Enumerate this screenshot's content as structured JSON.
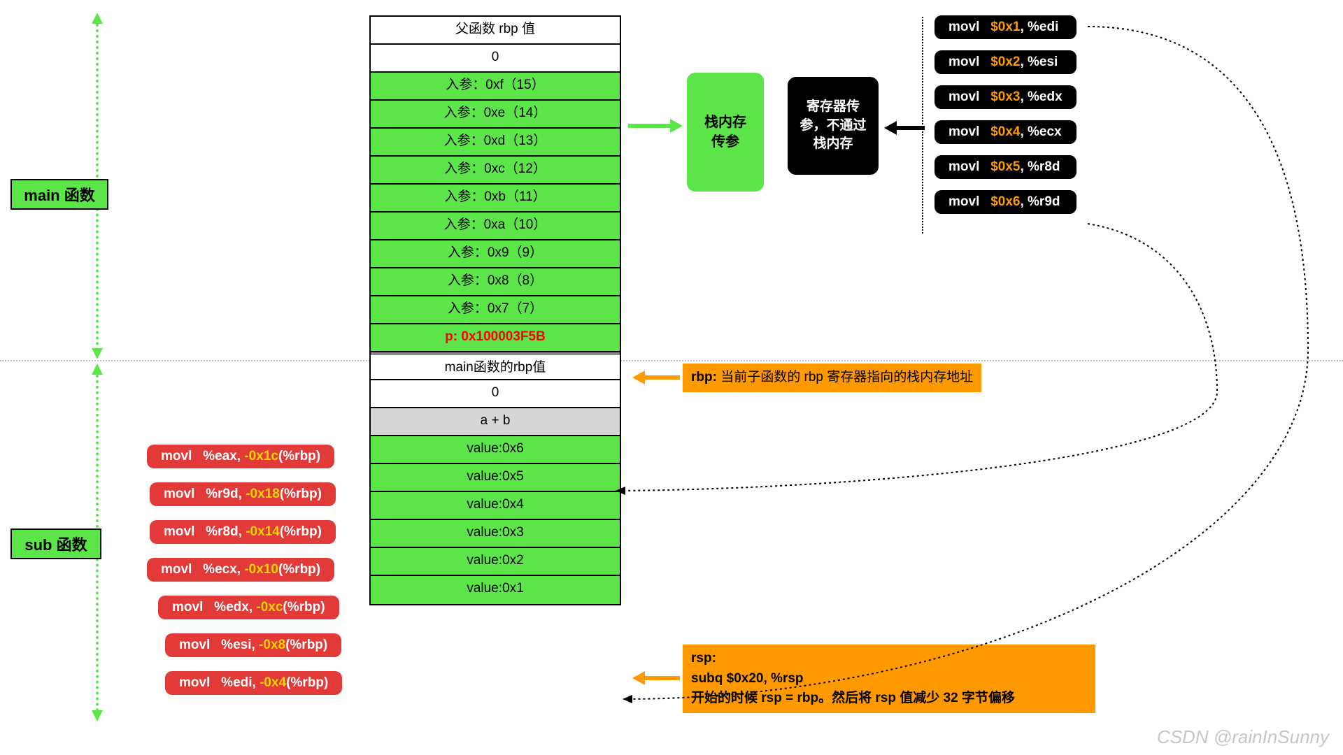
{
  "labels": {
    "main": "main 函数",
    "sub": "sub 函数"
  },
  "stack": {
    "r0": "父函数 rbp 值",
    "r1": "0",
    "r2": "入参：0xf（15）",
    "r3": "入参：0xe（14）",
    "r4": "入参：0xd（13）",
    "r5": "入参：0xc（12）",
    "r6": "入参：0xb（11）",
    "r7": "入参：0xa（10）",
    "r8": "入参：0x9（9）",
    "r9": "入参：0x8（8）",
    "r10": "入参：0x7（7）",
    "r11": "p: 0x100003F5B",
    "r12": "main函数的rbp值",
    "r13": "0",
    "r14": "a + b",
    "r15": "value:0x6",
    "r16": "value:0x5",
    "r17": "value:0x4",
    "r18": "value:0x3",
    "r19": "value:0x2",
    "r20": "value:0x1"
  },
  "greenCallout": "栈内存\n传参",
  "blackCallout": "寄存器传参，不通过栈内存",
  "asmRight": [
    {
      "pre": "movl   ",
      "hex": "$0x1",
      "post": ", %edi"
    },
    {
      "pre": "movl   ",
      "hex": "$0x2",
      "post": ", %esi"
    },
    {
      "pre": "movl   ",
      "hex": "$0x3",
      "post": ", %edx"
    },
    {
      "pre": "movl   ",
      "hex": "$0x4",
      "post": ", %ecx"
    },
    {
      "pre": "movl   ",
      "hex": "$0x5",
      "post": ", %r8d"
    },
    {
      "pre": "movl   ",
      "hex": "$0x6",
      "post": ", %r9d"
    }
  ],
  "orange": {
    "rbp_lead": "rbp: ",
    "rbp": "当前子函数的 rbp 寄存器指向的栈内存地址",
    "rsp": "rsp:\nsubq   $0x20, %rsp\n开始的时候 rsp = rbp。然后将 rsp 值减少 32 字节偏移"
  },
  "asmLeft": [
    {
      "pre": "movl   %eax, ",
      "off": "-0x1c",
      "post": "(%rbp)"
    },
    {
      "pre": "movl   %r9d, ",
      "off": "-0x18",
      "post": "(%rbp)"
    },
    {
      "pre": "movl   %r8d, ",
      "off": "-0x14",
      "post": "(%rbp)"
    },
    {
      "pre": "movl   %ecx, ",
      "off": "-0x10",
      "post": "(%rbp)"
    },
    {
      "pre": "movl   %edx, ",
      "off": "-0xc",
      "post": "(%rbp)"
    },
    {
      "pre": "movl   %esi, ",
      "off": "-0x8",
      "post": "(%rbp)"
    },
    {
      "pre": "movl   %edi, ",
      "off": "-0x4",
      "post": "(%rbp)"
    }
  ],
  "watermark": "CSDN @rainInSunny"
}
